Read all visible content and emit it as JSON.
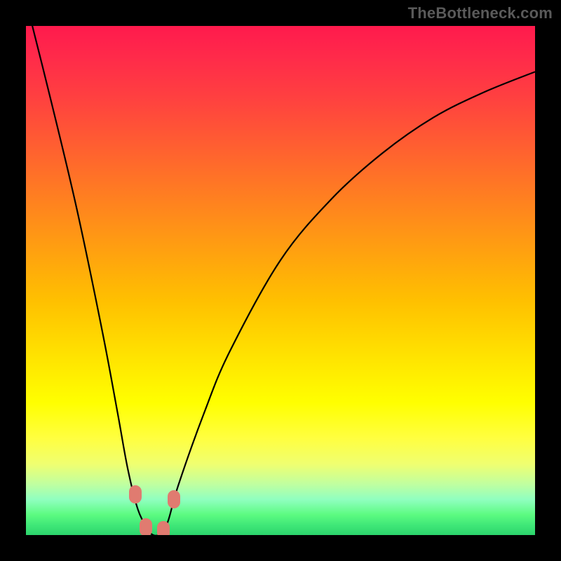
{
  "attribution": "TheBottleneck.com",
  "chart_data": {
    "type": "line",
    "title": "",
    "xlabel": "",
    "ylabel": "",
    "xlim": [
      0,
      100
    ],
    "ylim": [
      0,
      100
    ],
    "series": [
      {
        "name": "bottleneck-curve",
        "x": [
          0,
          5,
          10,
          15,
          18,
          20,
          22,
          24,
          25,
          26,
          27,
          28,
          30,
          35,
          40,
          50,
          60,
          70,
          80,
          90,
          100
        ],
        "values": [
          105,
          85,
          64,
          40,
          24,
          13,
          5,
          1,
          0,
          0,
          1,
          3,
          10,
          24,
          36,
          54,
          66,
          75,
          82,
          87,
          91
        ]
      }
    ],
    "markers": [
      {
        "x": 21.5,
        "y": 8
      },
      {
        "x": 23.5,
        "y": 1.5
      },
      {
        "x": 27.0,
        "y": 1.0
      },
      {
        "x": 29.0,
        "y": 7
      }
    ],
    "colors": {
      "curve": "#000000",
      "marker": "#e07b70",
      "gradient_top": "#ff1a4d",
      "gradient_bottom": "#2cd46c"
    }
  }
}
